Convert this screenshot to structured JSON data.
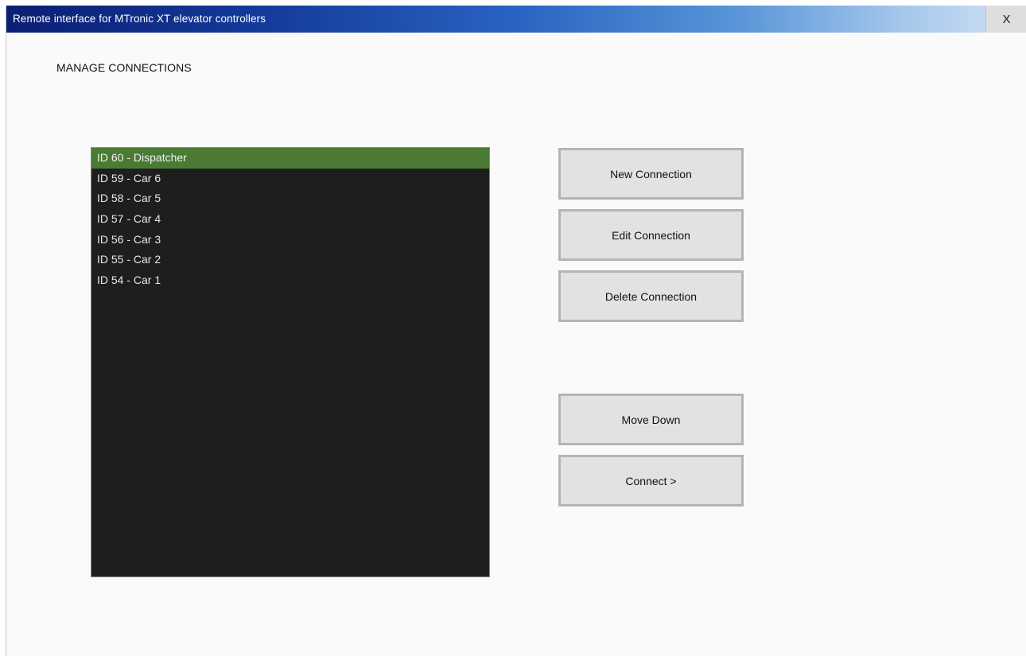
{
  "window": {
    "title": "Remote interface for MTronic XT elevator controllers",
    "close_label": "X"
  },
  "page": {
    "heading": "MANAGE CONNECTIONS"
  },
  "connections": {
    "selected_index": 0,
    "items": [
      {
        "label": "ID 60 - Dispatcher"
      },
      {
        "label": "ID 59 - Car 6"
      },
      {
        "label": "ID 58 - Car 5"
      },
      {
        "label": "ID 57 - Car 4"
      },
      {
        "label": "ID 56 - Car 3"
      },
      {
        "label": "ID 55 - Car 2"
      },
      {
        "label": "ID 54 - Car 1"
      }
    ]
  },
  "actions": {
    "new_label": "New Connection",
    "edit_label": "Edit Connection",
    "delete_label": "Delete Connection",
    "move_down_label": "Move Down",
    "connect_label": "Connect >"
  },
  "colors": {
    "titlebar_start": "#0a1f73",
    "titlebar_end": "#d4e3f4",
    "list_background": "#1e1e1e",
    "selection": "#4a7a34",
    "button_face": "#e2e2e2"
  }
}
